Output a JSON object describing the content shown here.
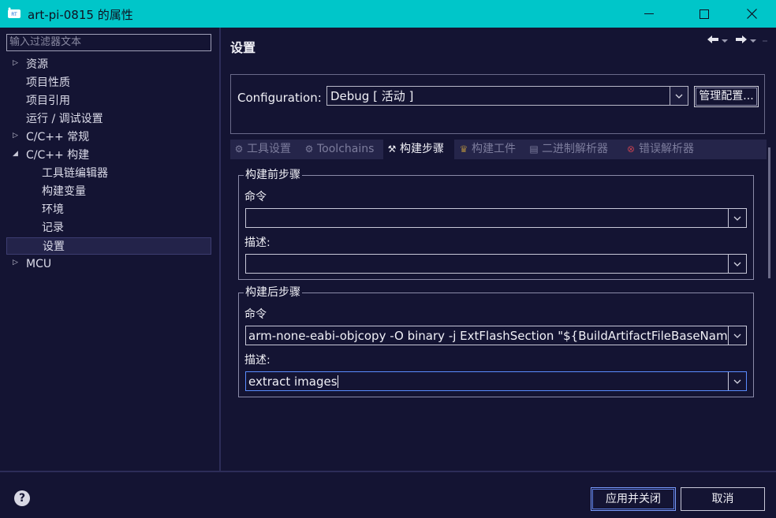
{
  "window": {
    "title": "art-pi-0815 的属性"
  },
  "filter": {
    "placeholder": "输入过滤器文本"
  },
  "tree": {
    "resources": "资源",
    "project_nature": "项目性质",
    "project_references": "项目引用",
    "run_debug": "运行 / 调试设置",
    "cpp_general": "C/C++ 常规",
    "cpp_build": "C/C++ 构建",
    "toolchain_editor": "工具链编辑器",
    "build_variables": "构建变量",
    "environment": "环境",
    "logging": "记录",
    "settings": "设置",
    "mcu": "MCU"
  },
  "panel": {
    "title": "设置"
  },
  "config": {
    "label": "Configuration:",
    "value": "Debug  [ 活动 ]",
    "manage_label": "管理配置..."
  },
  "tabs": {
    "tool_settings": "工具设置",
    "toolchains": "Toolchains",
    "build_steps": "构建步骤",
    "build_artifact": "构建工件",
    "binary_parsers": "二进制解析器",
    "error_parsers": "错误解析器"
  },
  "prebuild": {
    "legend": "构建前步骤",
    "command_label": "命令",
    "command_value": "",
    "desc_label": "描述:",
    "desc_value": ""
  },
  "postbuild": {
    "legend": "构建后步骤",
    "command_label": "命令",
    "command_value": "arm-none-eabi-objcopy -O binary -j ExtFlashSection \"${BuildArtifactFileBaseName}.e",
    "desc_label": "描述:",
    "desc_value": "extract images"
  },
  "buttons": {
    "apply_close": "应用并关闭",
    "cancel": "取消"
  },
  "colors": {
    "titlebar": "#00c6c9",
    "background": "#141433",
    "focus_border": "#5a8cff"
  }
}
